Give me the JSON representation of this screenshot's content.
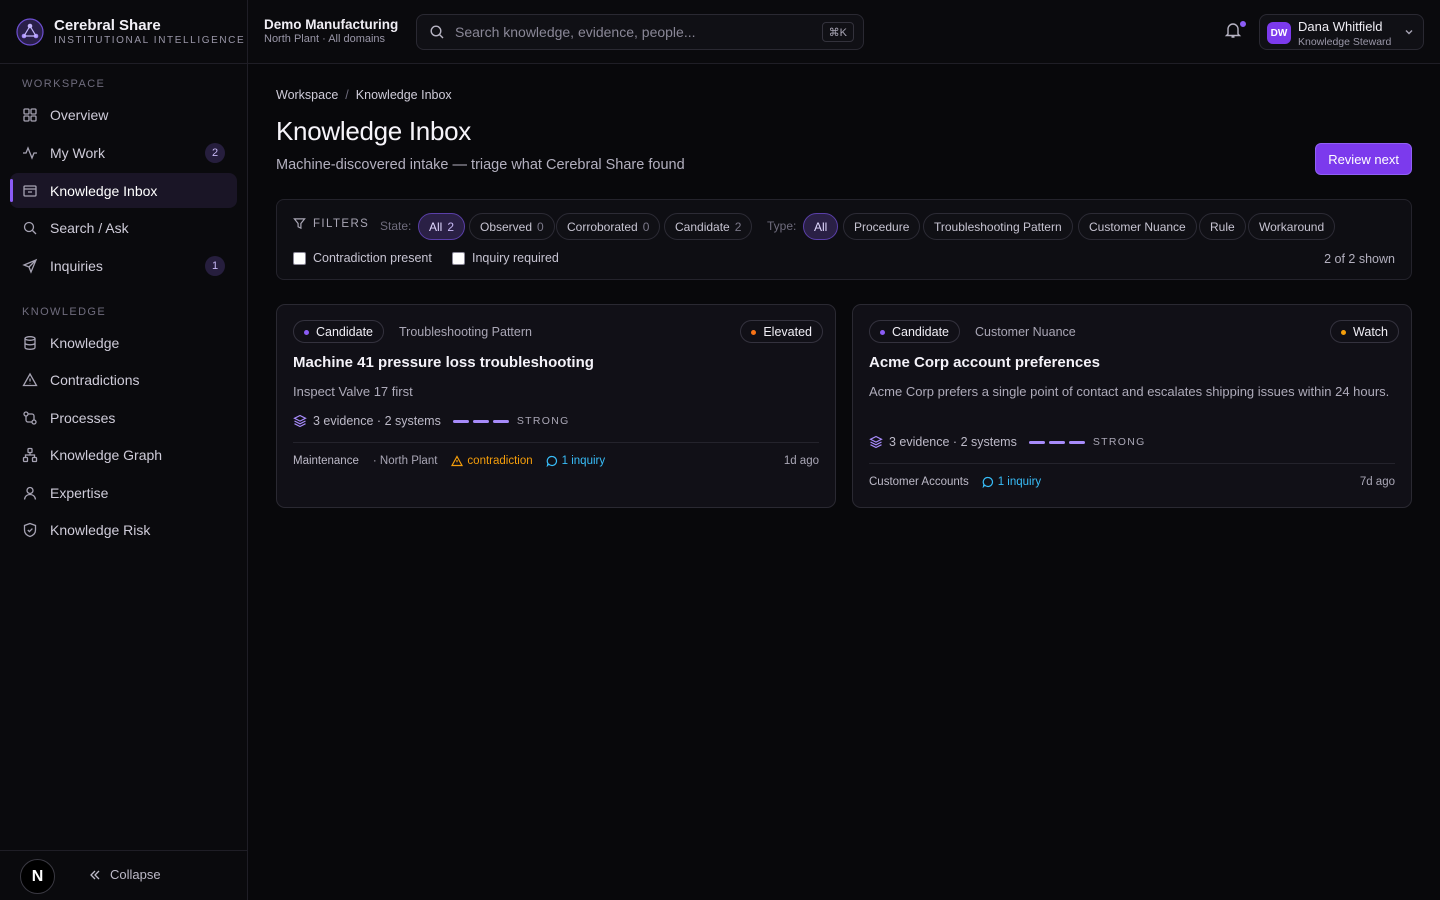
{
  "brand": {
    "name": "Cerebral Share",
    "tagline": "INSTITUTIONAL INTELLIGENCE"
  },
  "sidebar": {
    "sections": [
      {
        "label": "WORKSPACE"
      },
      {
        "label": "KNOWLEDGE"
      }
    ],
    "items": [
      {
        "label": "Overview",
        "icon": "grid-icon"
      },
      {
        "label": "My Work",
        "icon": "activity-icon",
        "badge": "2"
      },
      {
        "label": "Knowledge Inbox",
        "icon": "inbox-icon",
        "active": true
      },
      {
        "label": "Search / Ask",
        "icon": "search-icon"
      },
      {
        "label": "Inquiries",
        "icon": "send-icon",
        "badge": "1"
      },
      {
        "label": "Knowledge",
        "icon": "database-icon"
      },
      {
        "label": "Contradictions",
        "icon": "warning-icon"
      },
      {
        "label": "Processes",
        "icon": "workflow-icon"
      },
      {
        "label": "Knowledge Graph",
        "icon": "network-icon"
      },
      {
        "label": "Expertise",
        "icon": "user-icon"
      },
      {
        "label": "Knowledge Risk",
        "icon": "shield-icon"
      }
    ],
    "footer": {
      "avatar_letter": "N",
      "collapse_label": "Collapse"
    }
  },
  "topbar": {
    "org_name": "Demo Manufacturing",
    "org_scope": "North Plant · All domains",
    "search_placeholder": "Search knowledge, evidence, people...",
    "search_shortcut": "⌘K",
    "user": {
      "initials": "DW",
      "name": "Dana Whitfield",
      "role": "Knowledge Steward"
    }
  },
  "page": {
    "breadcrumb": [
      "Workspace",
      "Knowledge Inbox"
    ],
    "title": "Knowledge Inbox",
    "subtitle": "Machine-discovered intake — triage what Cerebral Share found",
    "review_button": "Review next"
  },
  "filters": {
    "label": "FILTERS",
    "state_label": "State:",
    "states": [
      {
        "label": "All",
        "count": "2",
        "active": true
      },
      {
        "label": "Observed",
        "count": "0"
      },
      {
        "label": "Corroborated",
        "count": "0"
      },
      {
        "label": "Candidate",
        "count": "2"
      }
    ],
    "type_label": "Type:",
    "types": [
      {
        "label": "All",
        "active": true
      },
      {
        "label": "Procedure"
      },
      {
        "label": "Troubleshooting Pattern"
      },
      {
        "label": "Customer Nuance"
      },
      {
        "label": "Rule"
      },
      {
        "label": "Workaround"
      }
    ],
    "checks": [
      {
        "label": "Contradiction present",
        "checked": false
      },
      {
        "label": "Inquiry required",
        "checked": false
      }
    ],
    "shown": "2 of 2 shown"
  },
  "cards": [
    {
      "state": "Candidate",
      "type": "Troubleshooting Pattern",
      "risk": "Elevated",
      "title": "Machine 41 pressure loss troubleshooting",
      "summary": "Inspect Valve 17 first",
      "evidence": "3 evidence · 2 systems",
      "strength": "STRONG",
      "domain": "Maintenance",
      "site": "· North Plant",
      "contradiction": "contradiction",
      "inquiry": "1 inquiry",
      "age": "1d ago"
    },
    {
      "state": "Candidate",
      "type": "Customer Nuance",
      "risk": "Watch",
      "title": "Acme Corp account preferences",
      "summary": "Acme Corp prefers a single point of contact and escalates shipping issues within 24 hours.",
      "evidence": "3 evidence · 2 systems",
      "strength": "STRONG",
      "domain": "Customer Accounts",
      "inquiry": "1 inquiry",
      "age": "7d ago"
    }
  ],
  "colors": {
    "accent": "#7c3aed",
    "elevated": "#f97316",
    "watch": "#f59e0b",
    "inquiry": "#38bdf8",
    "background": "#08080b"
  }
}
